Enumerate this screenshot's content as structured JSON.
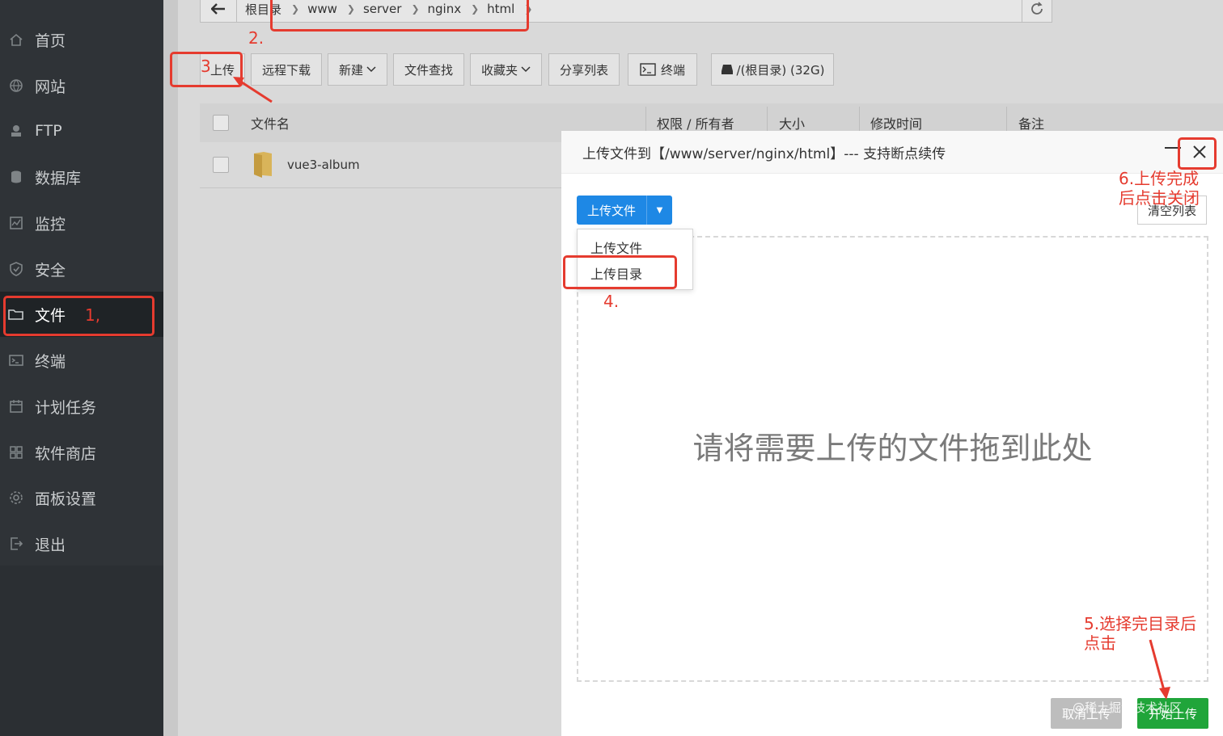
{
  "sidebar": {
    "items": [
      {
        "label": "首页",
        "icon": "home-icon"
      },
      {
        "label": "网站",
        "icon": "globe-icon"
      },
      {
        "label": "FTP",
        "icon": "ftp-icon"
      },
      {
        "label": "数据库",
        "icon": "database-icon"
      },
      {
        "label": "监控",
        "icon": "monitor-icon"
      },
      {
        "label": "安全",
        "icon": "shield-icon"
      },
      {
        "label": "文件",
        "icon": "folder-icon",
        "active": true
      },
      {
        "label": "终端",
        "icon": "terminal-icon"
      },
      {
        "label": "计划任务",
        "icon": "calendar-icon"
      },
      {
        "label": "软件商店",
        "icon": "grid-icon"
      },
      {
        "label": "面板设置",
        "icon": "gear-icon"
      },
      {
        "label": "退出",
        "icon": "logout-icon"
      }
    ]
  },
  "breadcrumb": [
    "根目录",
    "www",
    "server",
    "nginx",
    "html"
  ],
  "toolbar": {
    "upload": "上传",
    "remote_download": "远程下载",
    "new": "新建",
    "search": "文件查找",
    "favorites": "收藏夹",
    "share_list": "分享列表",
    "terminal": "终端",
    "disk": "/(根目录) (32G)"
  },
  "table": {
    "headers": {
      "name": "文件名",
      "perm": "权限 / 所有者",
      "size": "大小",
      "mtime": "修改时间",
      "note": "备注"
    },
    "rows": [
      {
        "name": "vue3-album"
      }
    ]
  },
  "modal": {
    "title": "上传文件到【/www/server/nginx/html】--- 支持断点续传",
    "upload_button": "上传文件",
    "dropdown": [
      "上传文件",
      "上传目录"
    ],
    "clear_button": "清空列表",
    "drop_hint": "请将需要上传的文件拖到此处",
    "cancel_button": "取消上传",
    "start_button": "开始上传"
  },
  "annotations": {
    "a1": "1,",
    "a2": "2.",
    "a3": "3",
    "a4": "4.",
    "a5": "5.选择完目录后\n点击",
    "a6": "6.上传完成\n后点击关闭"
  },
  "watermark": "@稀土掘金技术社区",
  "colors": {
    "accent": "#1e88e5",
    "start": "#20a53a",
    "annotation": "#e53b2f",
    "sidebar": "#2f3337"
  }
}
